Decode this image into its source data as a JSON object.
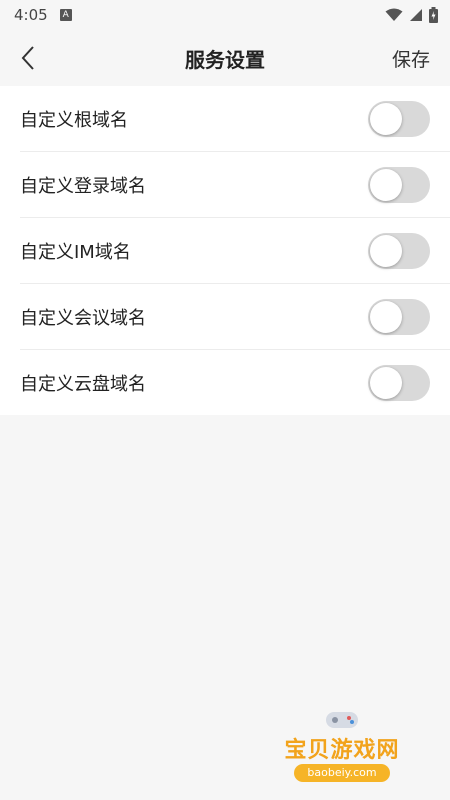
{
  "status_bar": {
    "time": "4:05",
    "badge": "A"
  },
  "header": {
    "title": "服务设置",
    "save_label": "保存"
  },
  "settings": [
    {
      "label": "自定义根域名",
      "enabled": false
    },
    {
      "label": "自定义登录域名",
      "enabled": false
    },
    {
      "label": "自定义IM域名",
      "enabled": false
    },
    {
      "label": "自定义会议域名",
      "enabled": false
    },
    {
      "label": "自定义云盘域名",
      "enabled": false
    }
  ],
  "watermark": {
    "text": "宝贝游戏网",
    "url": "baobeiy.com"
  }
}
